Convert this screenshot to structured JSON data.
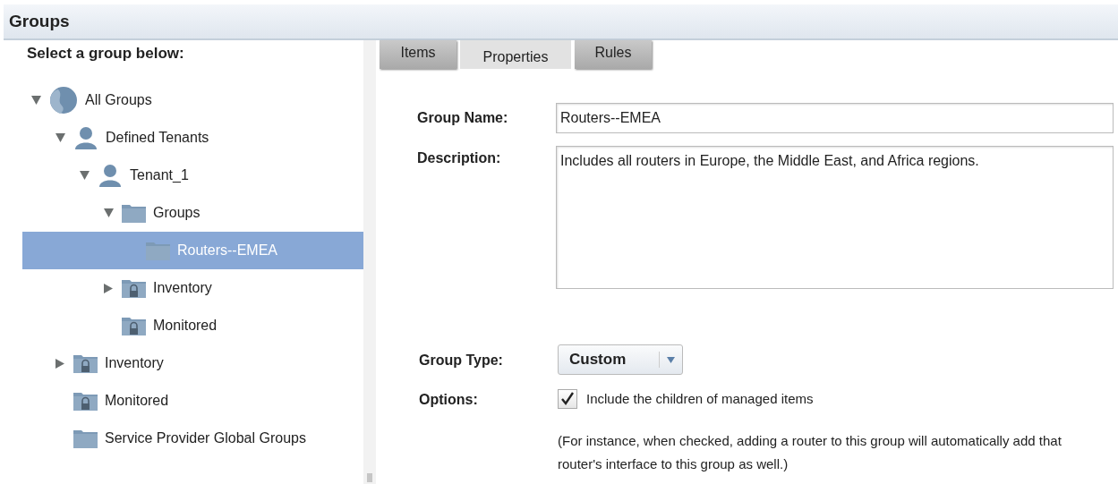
{
  "header": {
    "title": "Groups"
  },
  "tree": {
    "heading": "Select a group below:",
    "items": [
      {
        "label": "All Groups",
        "kind": "globe",
        "expanded": true,
        "selected": false,
        "children": [
          {
            "label": "Defined Tenants",
            "kind": "person",
            "expanded": true,
            "selected": false,
            "children": [
              {
                "label": "Tenant_1",
                "kind": "person",
                "expanded": true,
                "selected": false,
                "children": [
                  {
                    "label": "Groups",
                    "kind": "folder",
                    "expanded": true,
                    "selected": false,
                    "children": [
                      {
                        "label": "Routers--EMEA",
                        "kind": "folder",
                        "selected": true
                      }
                    ]
                  },
                  {
                    "label": "Inventory",
                    "kind": "locked-folder",
                    "expanded": false,
                    "selected": false
                  },
                  {
                    "label": "Monitored",
                    "kind": "locked-folder",
                    "selected": false
                  }
                ]
              }
            ]
          },
          {
            "label": "Inventory",
            "kind": "locked-folder",
            "expanded": false,
            "selected": false
          },
          {
            "label": "Monitored",
            "kind": "locked-folder",
            "selected": false
          },
          {
            "label": "Service Provider Global Groups",
            "kind": "folder",
            "selected": false
          }
        ]
      }
    ]
  },
  "tabs": [
    {
      "label": "Items",
      "selected": false
    },
    {
      "label": "Properties",
      "selected": true
    },
    {
      "label": "Rules",
      "selected": false
    }
  ],
  "form": {
    "group_name": {
      "label": "Group Name:",
      "value": "Routers--EMEA"
    },
    "description": {
      "label": "Description:",
      "value": "Includes all routers in Europe, the Middle East, and Africa regions."
    },
    "group_type": {
      "label": "Group Type:",
      "value": "Custom"
    },
    "options": {
      "label": "Options:",
      "checkbox": {
        "label": "Include the children of managed items",
        "checked": true
      },
      "note": "(For instance, when checked, adding a router to this group will automatically add that router's interface to this group as well.)"
    }
  }
}
